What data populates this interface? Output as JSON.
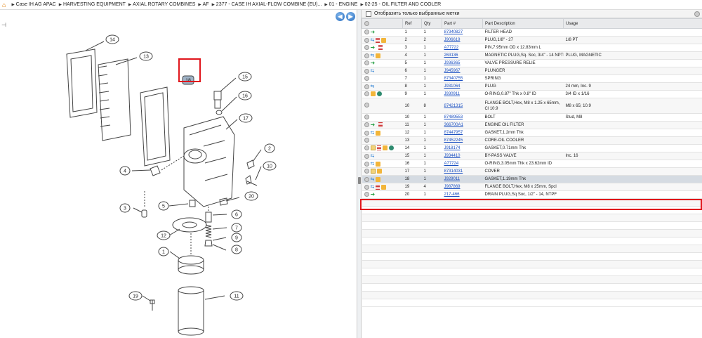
{
  "breadcrumb": {
    "items": [
      "Case IH AG APAC",
      "HARVESTING EQUIPMENT",
      "AXIAL ROTARY COMBINES",
      "AF",
      "2377 - CASE IH AXIAL-FLOW COMBINE (EU)...",
      "01 - ENGINE",
      "02-25 - OIL FILTER AND COOLER"
    ]
  },
  "nav": {
    "back": "◀",
    "forward": "▶"
  },
  "filter_label": "Отобразить только выбранные метки",
  "columns": [
    "Ref",
    "Qty",
    "Part #",
    "Part Description",
    "Usage"
  ],
  "parts": [
    {
      "icons": [
        "arrow"
      ],
      "ref": "1",
      "qty": "1",
      "part": "87340827",
      "desc": "FILTER HEAD",
      "usage": ""
    },
    {
      "icons": [
        "swap",
        "doc",
        "box"
      ],
      "ref": "2",
      "qty": "2",
      "part": "J906619",
      "desc": "PLUG,1/8\" - 27",
      "usage": "1/8 PT"
    },
    {
      "icons": [
        "arrow",
        "doc"
      ],
      "ref": "3",
      "qty": "1",
      "part": "A77722",
      "desc": "PIN,7.95mm OD x 12.83mm L",
      "usage": ""
    },
    {
      "icons": [
        "swap",
        "box"
      ],
      "ref": "4",
      "qty": "1",
      "part": "263136",
      "desc": "MAGNETIC PLUG,Sq. Soc, 3/4\" - 14 NPTF",
      "usage": "PLUG, MAGNETIC"
    },
    {
      "icons": [
        "arrow"
      ],
      "ref": "5",
      "qty": "1",
      "part": "J936365",
      "desc": "VALVE PRESSURE RELIE",
      "usage": ""
    },
    {
      "icons": [
        "swap"
      ],
      "ref": "6",
      "qty": "1",
      "part": "J945967",
      "desc": "PLUNGER",
      "usage": ""
    },
    {
      "icons": [],
      "ref": "7",
      "qty": "1",
      "part": "87340755",
      "desc": "SPRING",
      "usage": ""
    },
    {
      "icons": [
        "swap"
      ],
      "ref": "8",
      "qty": "1",
      "part": "J931064",
      "desc": "PLUG",
      "usage": "24 mm, Inc. 9"
    },
    {
      "icons": [
        "box",
        "glob"
      ],
      "ref": "9",
      "qty": "1",
      "part": "J930911",
      "desc": "O-RING,0.87\" Thk x 0.8\" ID",
      "usage": "3/4 ID x 1/16"
    },
    {
      "icons": [],
      "ref": "10",
      "qty": "8",
      "part": "87421315",
      "desc": "FLANGE BOLT,Hex, M8 x 1.25 x 65mm, Cl 10.9",
      "usage": "M8 x 65; 10.9",
      "tall": true
    },
    {
      "icons": [],
      "ref": "10",
      "qty": "1",
      "part": "87489553",
      "desc": "BOLT",
      "usage": "Stud, M8"
    },
    {
      "icons": [
        "arrow",
        "doc"
      ],
      "ref": "11",
      "qty": "1",
      "part": "366700A1",
      "desc": "ENGINE OIL FILTER",
      "usage": ""
    },
    {
      "icons": [
        "swap",
        "box"
      ],
      "ref": "12",
      "qty": "1",
      "part": "87447957",
      "desc": "GASKET,1.2mm Thk",
      "usage": ""
    },
    {
      "icons": [],
      "ref": "13",
      "qty": "1",
      "part": "87452245",
      "desc": "CORE-OIL COOLER",
      "usage": ""
    },
    {
      "icons": [
        "note",
        "doc",
        "box",
        "glob"
      ],
      "ref": "14",
      "qty": "1",
      "part": "J918174",
      "desc": "GASKET,0.71mm Thk",
      "usage": ""
    },
    {
      "icons": [
        "swap"
      ],
      "ref": "15",
      "qty": "1",
      "part": "J934410",
      "desc": "BY-PASS VALVE",
      "usage": "Inc. 16"
    },
    {
      "icons": [
        "swap",
        "box"
      ],
      "ref": "16",
      "qty": "1",
      "part": "A77724",
      "desc": "O-RING,3.05mm Thk x 23.62mm ID",
      "usage": ""
    },
    {
      "icons": [
        "note",
        "box"
      ],
      "ref": "17",
      "qty": "1",
      "part": "87314031",
      "desc": "COVER",
      "usage": ""
    },
    {
      "icons": [
        "swap",
        "box"
      ],
      "ref": "18",
      "qty": "1",
      "part": "J929011",
      "desc": "GASKET,1.19mm Thk",
      "usage": "",
      "selected": true
    },
    {
      "icons": [
        "swap",
        "doc",
        "box"
      ],
      "ref": "19",
      "qty": "4",
      "part": "J987869",
      "desc": "FLANGE BOLT,Hex, M8 x 25mm, Spcl",
      "usage": ""
    },
    {
      "icons": [
        "arrow"
      ],
      "ref": "20",
      "qty": "1",
      "part": "217-466",
      "desc": "DRAIN PLUG,Sq Soc, 1/2\" - 14, NTPF",
      "usage": ""
    }
  ],
  "callouts": [
    "14",
    "13",
    "18",
    "15",
    "16",
    "17",
    "2",
    "10",
    "4",
    "20",
    "3",
    "5",
    "6",
    "7",
    "12",
    "9",
    "1",
    "8",
    "19",
    "11"
  ]
}
